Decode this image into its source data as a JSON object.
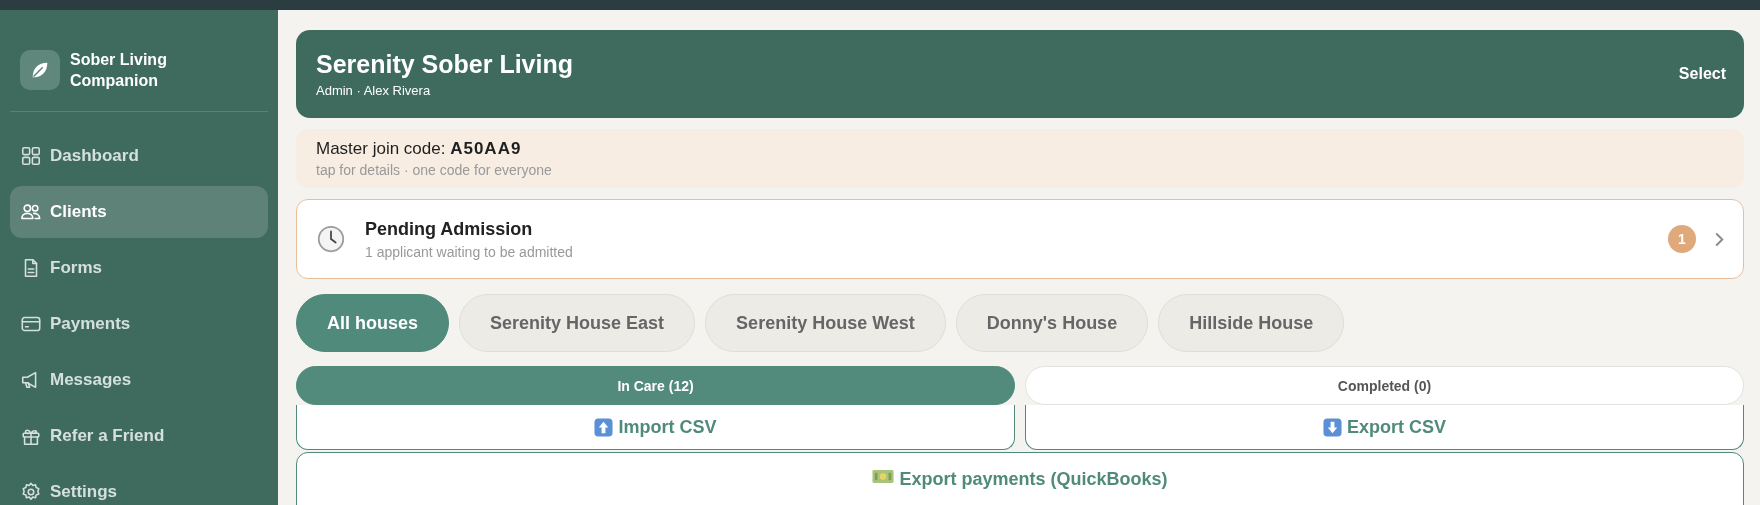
{
  "app": {
    "name": "Sober Living Companion"
  },
  "sidebar": {
    "items": [
      {
        "label": "Dashboard",
        "kind": "grid",
        "selected": false
      },
      {
        "label": "Clients",
        "kind": "users",
        "selected": true
      },
      {
        "label": "Forms",
        "kind": "doc",
        "selected": false
      },
      {
        "label": "Payments",
        "kind": "card",
        "selected": false
      },
      {
        "label": "Messages",
        "kind": "megaphone",
        "selected": false
      },
      {
        "label": "Refer a Friend",
        "kind": "gift",
        "selected": false
      },
      {
        "label": "Settings",
        "kind": "gear",
        "selected": false
      }
    ]
  },
  "header": {
    "title": "Serenity Sober Living",
    "subtitle": "Admin · Alex Rivera",
    "action": "Select"
  },
  "join_code": {
    "label": "Master join code:",
    "code": "A50AA9",
    "hint": "tap for details · one code for everyone"
  },
  "pending": {
    "title": "Pending Admission",
    "subtitle": "1 applicant waiting to be admitted",
    "count": "1"
  },
  "houses": [
    {
      "label": "All houses",
      "selected": true
    },
    {
      "label": "Serenity House East",
      "selected": false
    },
    {
      "label": "Serenity House West",
      "selected": false
    },
    {
      "label": "Donny's House",
      "selected": false
    },
    {
      "label": "Hillside House",
      "selected": false
    }
  ],
  "segments": [
    {
      "label": "In Care (12)",
      "selected": true
    },
    {
      "label": "Completed (0)",
      "selected": false
    }
  ],
  "actions": [
    {
      "label": "Import CSV",
      "kind": "import"
    },
    {
      "label": "Export CSV",
      "kind": "export"
    },
    {
      "label": "Export payments (QuickBooks)",
      "kind": "payments"
    }
  ]
}
